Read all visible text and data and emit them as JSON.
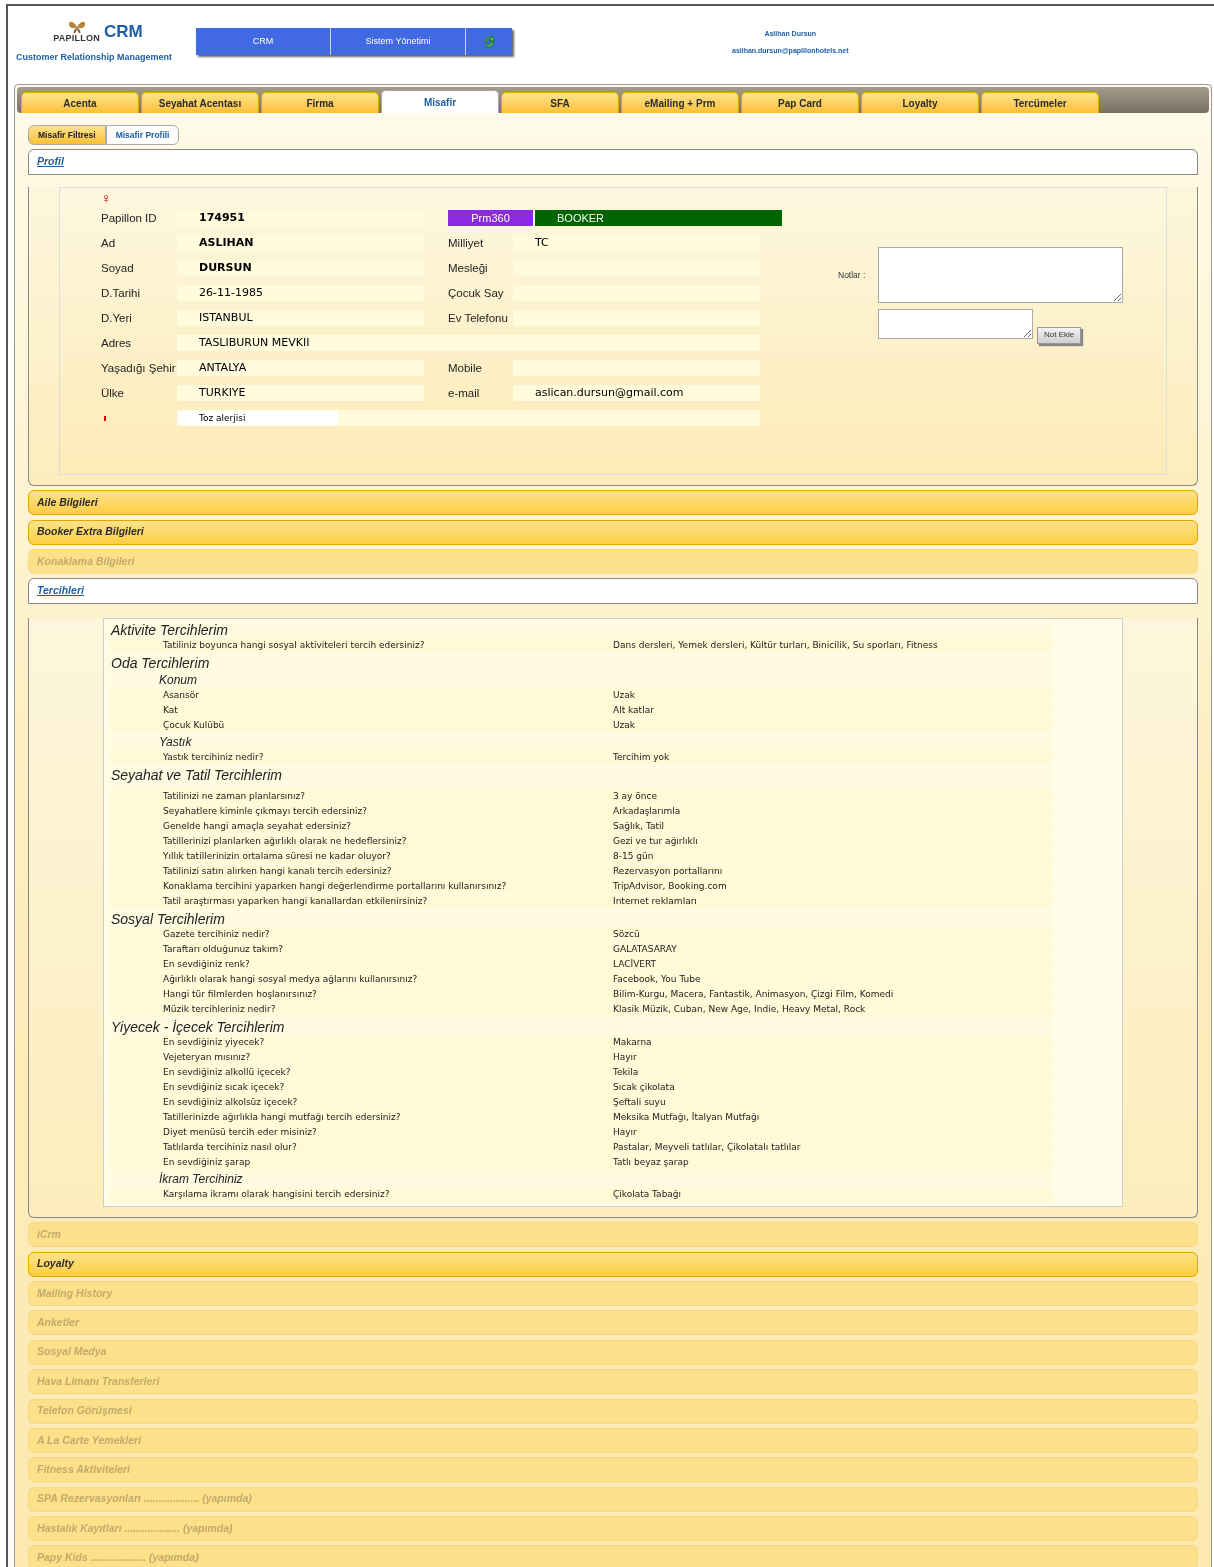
{
  "header": {
    "brand": "PAPILLON",
    "product": "CRM",
    "tagline": "Customer Relationship Management",
    "nav": [
      {
        "kind": "text",
        "label": "CRM"
      },
      {
        "kind": "text",
        "label": "Sistem Yönetimi"
      },
      {
        "kind": "refresh"
      }
    ],
    "user_name": "Aslihan Dursun",
    "user_email": "aslihan.dursun@papillonhotels.net"
  },
  "tabs": [
    {
      "label": "Acenta",
      "selected": false
    },
    {
      "label": "Seyahat Acentası",
      "selected": false
    },
    {
      "label": "Firma",
      "selected": false
    },
    {
      "label": "Misafir",
      "selected": true
    },
    {
      "label": "SFA",
      "selected": false
    },
    {
      "label": "eMailing + Prm",
      "selected": false
    },
    {
      "label": "Pap Card",
      "selected": false
    },
    {
      "label": "Loyalty",
      "selected": false
    },
    {
      "label": "Tercümeler",
      "selected": false
    }
  ],
  "subtabs": [
    {
      "label": "Misafir Filtresi",
      "selected": false
    },
    {
      "label": "Misafir Profili",
      "selected": true
    }
  ],
  "sections": [
    {
      "title": "Profil",
      "kind": "profile",
      "expanded": true,
      "disabled": false
    },
    {
      "title": "Aile Bilgileri",
      "kind": "plain",
      "expanded": false,
      "disabled": false
    },
    {
      "title": "Booker Extra Bilgileri",
      "kind": "plain",
      "expanded": false,
      "disabled": false
    },
    {
      "title": "Konaklama Bilgileri",
      "kind": "plain",
      "expanded": false,
      "disabled": true
    },
    {
      "title": "Tercihleri",
      "kind": "preferences",
      "expanded": true,
      "disabled": false
    },
    {
      "title": "iCrm",
      "kind": "plain",
      "expanded": false,
      "disabled": true
    },
    {
      "title": "Loyalty",
      "kind": "plain",
      "expanded": false,
      "disabled": false
    },
    {
      "title": "Mailing History",
      "kind": "plain",
      "expanded": false,
      "disabled": true
    },
    {
      "title": "Anketler",
      "kind": "plain",
      "expanded": false,
      "disabled": true
    },
    {
      "title": "Sosyal Medya",
      "kind": "plain",
      "expanded": false,
      "disabled": true
    },
    {
      "title": "Hava Limanı Transferleri",
      "kind": "plain",
      "expanded": false,
      "disabled": true
    },
    {
      "title": "Telefon Görüşmesi",
      "kind": "plain",
      "expanded": false,
      "disabled": true
    },
    {
      "title": "A La Carte Yemekleri",
      "kind": "plain",
      "expanded": false,
      "disabled": true
    },
    {
      "title": "Fitness Aktiviteleri",
      "kind": "plain",
      "expanded": false,
      "disabled": true
    },
    {
      "title": "SPA Rezervasyonları ................... (yapımda)",
      "kind": "plain",
      "expanded": false,
      "disabled": true
    },
    {
      "title": "Hastalık Kayıtları ................... (yapımda)",
      "kind": "plain",
      "expanded": false,
      "disabled": true
    },
    {
      "title": "Papy Kids ................... (yapımda)",
      "kind": "plain",
      "expanded": false,
      "disabled": true
    }
  ],
  "profile": {
    "gender_symbol": "♀",
    "badges": [
      {
        "label": "Prm360",
        "color": "#8a2be2"
      },
      {
        "label": "BOOKER",
        "color": "#006400"
      }
    ],
    "rows": [
      {
        "left": {
          "label": "Papillon ID",
          "value": "174951",
          "bold": true
        }
      },
      {
        "left": {
          "label": "Ad",
          "value": "ASLIHAN",
          "bold": true
        },
        "right": {
          "label": "Milliyet",
          "value": "TC"
        }
      },
      {
        "left": {
          "label": "Soyad",
          "value": "DURSUN",
          "bold": true
        },
        "right": {
          "label": "Mesleği"
        }
      },
      {
        "left": {
          "label": "D.Tarihi",
          "value": "26-11-1985",
          "bold": false
        },
        "right": {
          "label": "Çocuk Say"
        }
      },
      {
        "left": {
          "label": "D.Yeri",
          "value": "ISTANBUL",
          "bold": false
        },
        "right": {
          "label": "Ev Telefonu"
        }
      },
      {
        "left": {
          "label": "Adres",
          "value": "TASLIBURUN MEVKII",
          "bold": false
        },
        "wide": true
      },
      {
        "left": {
          "label": "Yaşadığı Şehir",
          "value": "ANTALYA",
          "bold": false
        },
        "right": {
          "label": "Mobile"
        }
      },
      {
        "left": {
          "label": "Ülke",
          "value": "TURKIYE",
          "bold": false
        },
        "right": {
          "label": "e-mail",
          "value": "aslican.dursun@gmail.com"
        }
      }
    ],
    "allergy": "Toz alerjisi",
    "notes_label": "Notlar :",
    "add_note": "Not Ekle"
  },
  "preferences": [
    {
      "title": "Aktivite Tercihlerim",
      "children": [
        {
          "kind": "row",
          "question": "Tatiliniz boyunca hangi sosyal aktiviteleri tercih edersiniz?",
          "answer": "Dans dersleri, Yemek dersleri, Kültür turları, Binicilik, Su sporları, Fitness"
        }
      ]
    },
    {
      "title": "Oda Tercihlerim",
      "children": [
        {
          "kind": "subgroup",
          "title": "Konum",
          "children": [
            {
              "kind": "row",
              "question": "Asansör",
              "answer": "Uzak"
            },
            {
              "kind": "row",
              "question": "Kat",
              "answer": "Alt katlar"
            },
            {
              "kind": "row",
              "question": "Çocuk Kulübü",
              "answer": "Uzak"
            }
          ]
        },
        {
          "kind": "subgroup",
          "title": "Yastık",
          "children": [
            {
              "kind": "row",
              "question": "Yastık tercihiniz nedir?",
              "answer": "Tercihim yok"
            }
          ]
        }
      ]
    },
    {
      "title": "Seyahat ve Tatil Tercihlerim",
      "children": [
        {
          "kind": "row",
          "question": "Tatilinizi ne zaman planlarsınız?",
          "answer": "3 ay önce"
        },
        {
          "kind": "row",
          "question": "Seyahatlere kiminle çıkmayı tercih edersiniz?",
          "answer": "Arkadaşlarımla"
        },
        {
          "kind": "row",
          "question": "Genelde hangi amaçla seyahat edersiniz?",
          "answer": "Sağlık, Tatil"
        },
        {
          "kind": "row",
          "question": "Tatillerinizi planlarken ağırlıklı olarak ne hedeflersiniz?",
          "answer": "Gezi ve tur ağırlıklı"
        },
        {
          "kind": "row",
          "question": "Yıllık tatillerinizin ortalama süresi ne kadar oluyor?",
          "answer": "8-15 gün"
        },
        {
          "kind": "row",
          "question": "Tatilinizi satın alırken hangi kanalı tercih edersiniz?",
          "answer": "Rezervasyon portallarını"
        },
        {
          "kind": "row",
          "question": "Konaklama tercihini yaparken hangi değerlendirme portallarını kullanırsınız?",
          "answer": "TripAdvisor, Booking.com"
        },
        {
          "kind": "row",
          "question": "Tatil araştırması yaparken hangi kanallardan etkilenirsiniz?",
          "answer": "Internet reklamları"
        }
      ]
    },
    {
      "title": "Sosyal Tercihlerim",
      "children": [
        {
          "kind": "row",
          "question": "Gazete tercihiniz nedir?",
          "answer": "Sözcü"
        },
        {
          "kind": "row",
          "question": "Taraftarı olduğunuz takım?",
          "answer": "GALATASARAY"
        },
        {
          "kind": "row",
          "question": "En sevdiğiniz renk?",
          "answer": "LACİVERT"
        },
        {
          "kind": "row",
          "question": "Ağırlıklı olarak hangi sosyal medya ağlarını kullanırsınız?",
          "answer": "Facebook, You Tube"
        },
        {
          "kind": "row",
          "question": "Hangi tür filmlerden hoşlanırsınız?",
          "answer": "Bilim-Kurgu, Macera, Fantastik, Animasyon, Çizgi Film, Komedi"
        },
        {
          "kind": "row",
          "question": "Müzik tercihleriniz nedir?",
          "answer": "Klasik Müzik, Cuban, New Age, Indie, Heavy Metal, Rock"
        }
      ]
    },
    {
      "title": "Yiyecek - İçecek Tercihlerim",
      "children": [
        {
          "kind": "row",
          "question": "En sevdiğiniz yiyecek?",
          "answer": "Makarna"
        },
        {
          "kind": "row",
          "question": "Vejeteryan mısınız?",
          "answer": "Hayır"
        },
        {
          "kind": "row",
          "question": "En sevdiğiniz alkollü içecek?",
          "answer": "Tekila"
        },
        {
          "kind": "row",
          "question": "En sevdiğiniz sıcak içecek?",
          "answer": "Sıcak çikolata"
        },
        {
          "kind": "row",
          "question": "En sevdiğiniz alkolsüz içecek?",
          "answer": "Şeftali suyu"
        },
        {
          "kind": "row",
          "question": "Tatillerinizde ağırlıkla hangi mutfağı tercih edersiniz?",
          "answer": "Meksika Mutfağı, İtalyan Mutfağı"
        },
        {
          "kind": "row",
          "question": "Diyet menüsü tercih eder misiniz?",
          "answer": "Hayır"
        },
        {
          "kind": "row",
          "question": "Tatlılarda tercihiniz nasıl olur?",
          "answer": "Pastalar, Meyveli tatlılar, Çikolatalı tatlılar"
        },
        {
          "kind": "row",
          "question": "En sevdiğiniz şarap",
          "answer": "Tatlı beyaz şarap"
        },
        {
          "kind": "subgroup",
          "title": "İkram Tercihiniz",
          "children": [
            {
              "kind": "row",
              "question": "Karşılama ikramı olarak hangisini tercih edersiniz?",
              "answer": "Çikolata Tabağı"
            }
          ]
        }
      ]
    }
  ]
}
